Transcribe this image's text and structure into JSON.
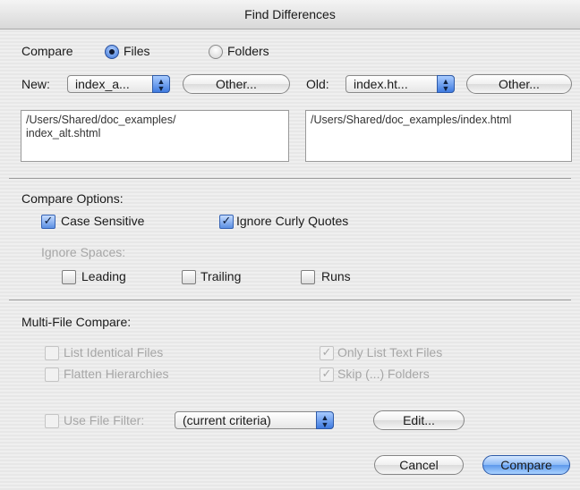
{
  "window": {
    "title": "Find Differences"
  },
  "compare": {
    "label": "Compare",
    "options": [
      {
        "label": "Files",
        "selected": true
      },
      {
        "label": "Folders",
        "selected": false
      }
    ]
  },
  "new_file": {
    "label": "New:",
    "popup_value": "index_a...",
    "other_button": "Other...",
    "path": "/Users/Shared/doc_examples/\nindex_alt.shtml"
  },
  "old_file": {
    "label": "Old:",
    "popup_value": "index.ht...",
    "other_button": "Other...",
    "path": "/Users/Shared/doc_examples/index.html"
  },
  "compare_options": {
    "heading": "Compare Options:",
    "case_sensitive": {
      "label": "Case Sensitive",
      "checked": true
    },
    "ignore_curly_quotes": {
      "label": "Ignore Curly Quotes",
      "checked": true
    },
    "ignore_spaces_label": "Ignore Spaces:",
    "leading": {
      "label": "Leading",
      "checked": false
    },
    "trailing": {
      "label": "Trailing",
      "checked": false
    },
    "runs": {
      "label": "Runs",
      "checked": false
    }
  },
  "multi_file": {
    "heading": "Multi-File Compare:",
    "list_identical": {
      "label": "List Identical Files",
      "checked": false,
      "enabled": false
    },
    "flatten_hierarchies": {
      "label": "Flatten Hierarchies",
      "checked": false,
      "enabled": false
    },
    "only_text_files": {
      "label": "Only List Text Files",
      "checked": true,
      "enabled": false
    },
    "skip_folders": {
      "label": "Skip (...) Folders",
      "checked": true,
      "enabled": false
    },
    "use_file_filter": {
      "label": "Use File Filter:",
      "checked": false,
      "enabled": false
    },
    "filter_popup_value": "(current criteria)",
    "edit_button": "Edit..."
  },
  "buttons": {
    "cancel": "Cancel",
    "compare": "Compare"
  },
  "icons": {
    "checkmark": "checkmark-icon",
    "popup_arrows": "popup-arrows-icon"
  }
}
